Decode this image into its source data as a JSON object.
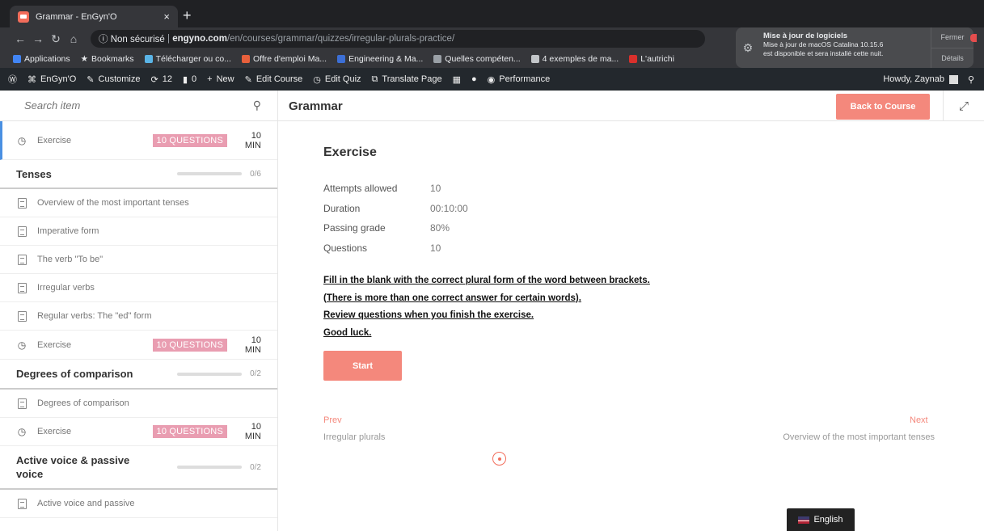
{
  "browser": {
    "tab_title": "Grammar - EnGyn'O",
    "tab_close": "×",
    "new_tab": "+",
    "security": "ⓘ Non sécurisé",
    "url_domain": "engyno.com",
    "url_path": "/en/courses/grammar/quizzes/irregular-plurals-practice/",
    "bookmarks": [
      "Applications",
      "Bookmarks",
      "Télécharger ou co...",
      "Offre d'emploi Ma...",
      "Engineering & Ma...",
      "Quelles compéten...",
      "4 exemples de ma...",
      "L'autrichi"
    ]
  },
  "notification": {
    "title": "Mise à jour de logiciels",
    "line1": "Mise à jour de macOS Catalina 10.15.6",
    "line2": "est disponible et sera installé cette nuit.",
    "close_label": "Fermer",
    "details_label": "Détails"
  },
  "admin_bar": {
    "site": "EnGyn'O",
    "customize": "Customize",
    "updates": "12",
    "comments": "0",
    "new": "New",
    "edit_course": "Edit Course",
    "edit_quiz": "Edit Quiz",
    "translate": "Translate Page",
    "performance": "Performance",
    "howdy": "Howdy, Zaynab"
  },
  "sidebar": {
    "search_placeholder": "Search item",
    "first_item": {
      "label": "Exercise",
      "badge": "10 QUESTIONS",
      "duration": "10 MIN"
    },
    "sections": [
      {
        "title": "Tenses",
        "count": "0/6",
        "items": [
          {
            "label": "Overview of the most important tenses"
          },
          {
            "label": "Imperative form"
          },
          {
            "label": "The verb \"To be\""
          },
          {
            "label": "Irregular verbs"
          },
          {
            "label": "Regular verbs: The \"ed\" form"
          }
        ],
        "exercise": {
          "label": "Exercise",
          "badge": "10 QUESTIONS",
          "duration": "10 MIN"
        }
      },
      {
        "title": "Degrees of comparison",
        "count": "0/2",
        "items": [
          {
            "label": "Degrees of comparison"
          }
        ],
        "exercise": {
          "label": "Exercise",
          "badge": "10 QUESTIONS",
          "duration": "10 MIN"
        }
      },
      {
        "title_line1": "Active voice & passive",
        "title_line2": "voice",
        "count": "0/2",
        "items": [
          {
            "label": "Active voice and passive"
          }
        ]
      }
    ]
  },
  "main": {
    "course_title": "Grammar",
    "back_button": "Back to Course",
    "quiz_title": "Exercise",
    "info": [
      {
        "key": "Attempts allowed",
        "value": "10"
      },
      {
        "key": "Duration",
        "value": "00:10:00"
      },
      {
        "key": "Passing grade",
        "value": "80%"
      },
      {
        "key": "Questions",
        "value": "10"
      }
    ],
    "instructions": [
      "Fill in the blank with the correct plural form of the word between brackets.",
      "(There is more than one correct answer for certain words).",
      "Review questions when you finish the exercise.",
      "Good luck."
    ],
    "start_button": "Start",
    "prev_label": "Prev",
    "prev_title": "Irregular plurals",
    "next_label": "Next",
    "next_title": "Overview of the most important tenses"
  },
  "language": "English",
  "colors": {
    "accent": "#f4887c",
    "badge": "#e99db1",
    "admin_bar": "#23282d",
    "active_border": "#4a90e2"
  }
}
